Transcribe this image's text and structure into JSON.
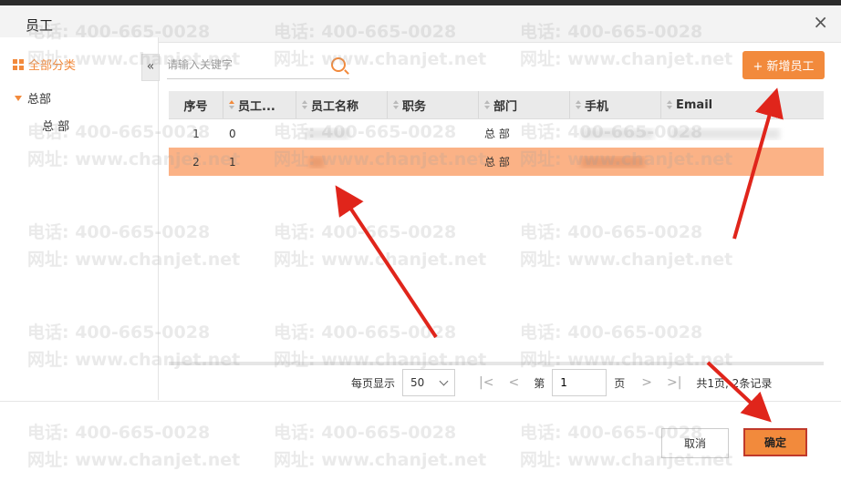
{
  "dialog": {
    "title": "员工",
    "close_label": "×"
  },
  "sidebar": {
    "all_label": "全部分类",
    "collapse_label": "«",
    "tree_root": "总部",
    "tree_child": "总 部"
  },
  "search": {
    "placeholder": "请输入关键字"
  },
  "add_button": {
    "label": "+ 新增员工"
  },
  "table": {
    "columns": [
      "序号",
      "员工...",
      "员工名称",
      "职务",
      "部门",
      "手机",
      "Email"
    ],
    "rows": [
      {
        "index": "1",
        "code": "0",
        "name": "",
        "title": "",
        "dept": "总 部",
        "phone": "",
        "email": ""
      },
      {
        "index": "2",
        "code": "1",
        "name": "",
        "title": "",
        "dept": "总 部",
        "phone": "",
        "email": ""
      }
    ]
  },
  "pager": {
    "per_page_label": "每页显示",
    "per_page_value": "50",
    "first_icon": "first-page-icon",
    "prev_icon": "prev-page-icon",
    "page_prefix": "第",
    "page_value": "1",
    "page_suffix": "页",
    "next_icon": "next-page-icon",
    "last_icon": "last-page-icon",
    "summary": "共1页, 2条记录"
  },
  "buttons": {
    "cancel": "取消",
    "ok": "确定"
  },
  "watermark": {
    "phone": "电话: 400-665-0028",
    "site": "网址: www.chanjet.net"
  },
  "colors": {
    "accent": "#f28a3c",
    "selected_row": "#fbb286",
    "annotation_arrow": "#e0251b"
  }
}
